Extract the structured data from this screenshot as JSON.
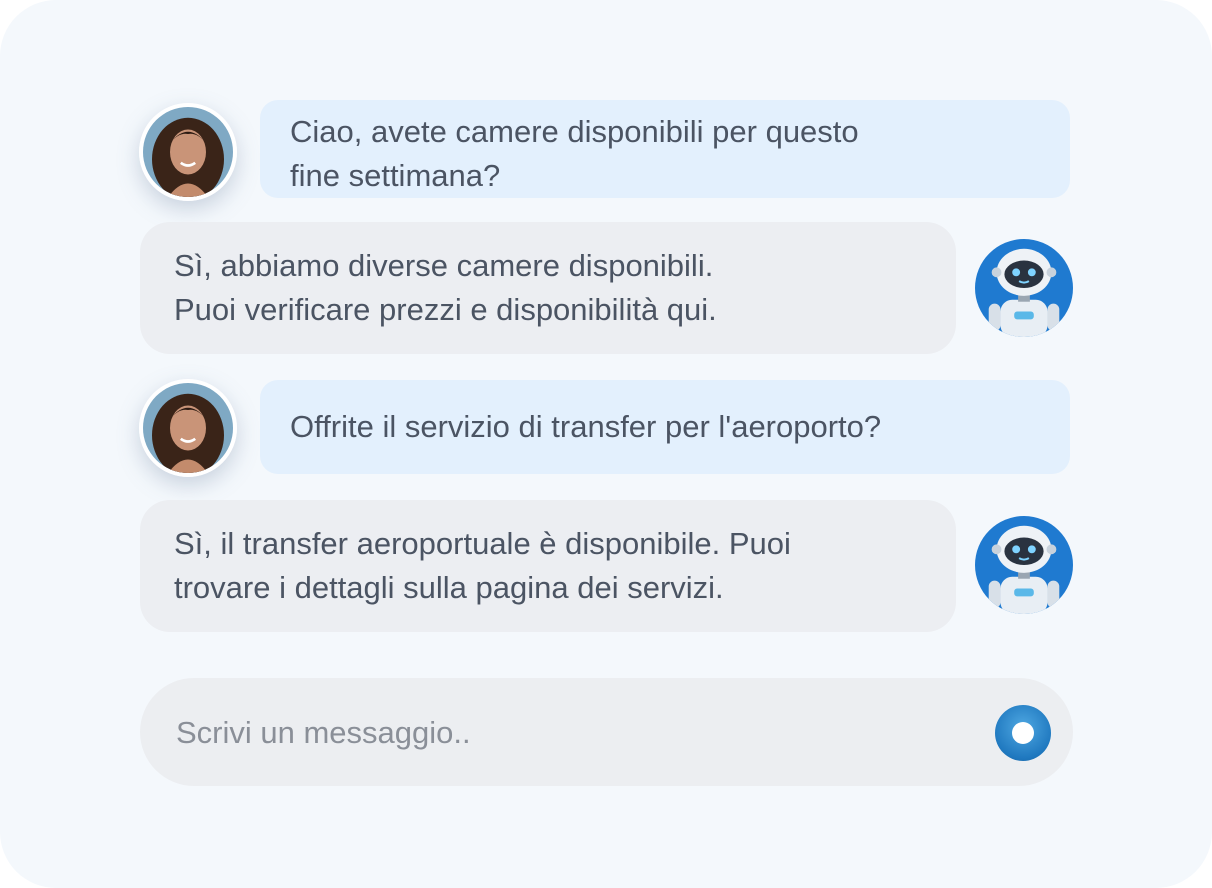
{
  "messages": [
    {
      "role": "user",
      "text": "Ciao, avete camere disponibili per questo\nfine settimana?"
    },
    {
      "role": "bot",
      "text": "Sì, abbiamo diverse camere disponibili.\nPuoi verificare prezzi e disponibilità qui."
    },
    {
      "role": "user",
      "text": "Offrite il servizio di transfer per l'aeroporto?"
    },
    {
      "role": "bot",
      "text": "Sì, il transfer aeroportuale è disponibile. Puoi\ntrovare i dettagli sulla pagina dei servizi."
    }
  ],
  "composer": {
    "placeholder": "Scrivi un messaggio.."
  },
  "icons": {
    "user_avatar": "user-avatar-photo",
    "bot_avatar": "robot-avatar",
    "send": "send-icon"
  },
  "colors": {
    "user_bubble": "#e3f0fd",
    "bot_bubble": "#eceef2",
    "accent": "#1f78bf",
    "text": "#4b5463"
  }
}
